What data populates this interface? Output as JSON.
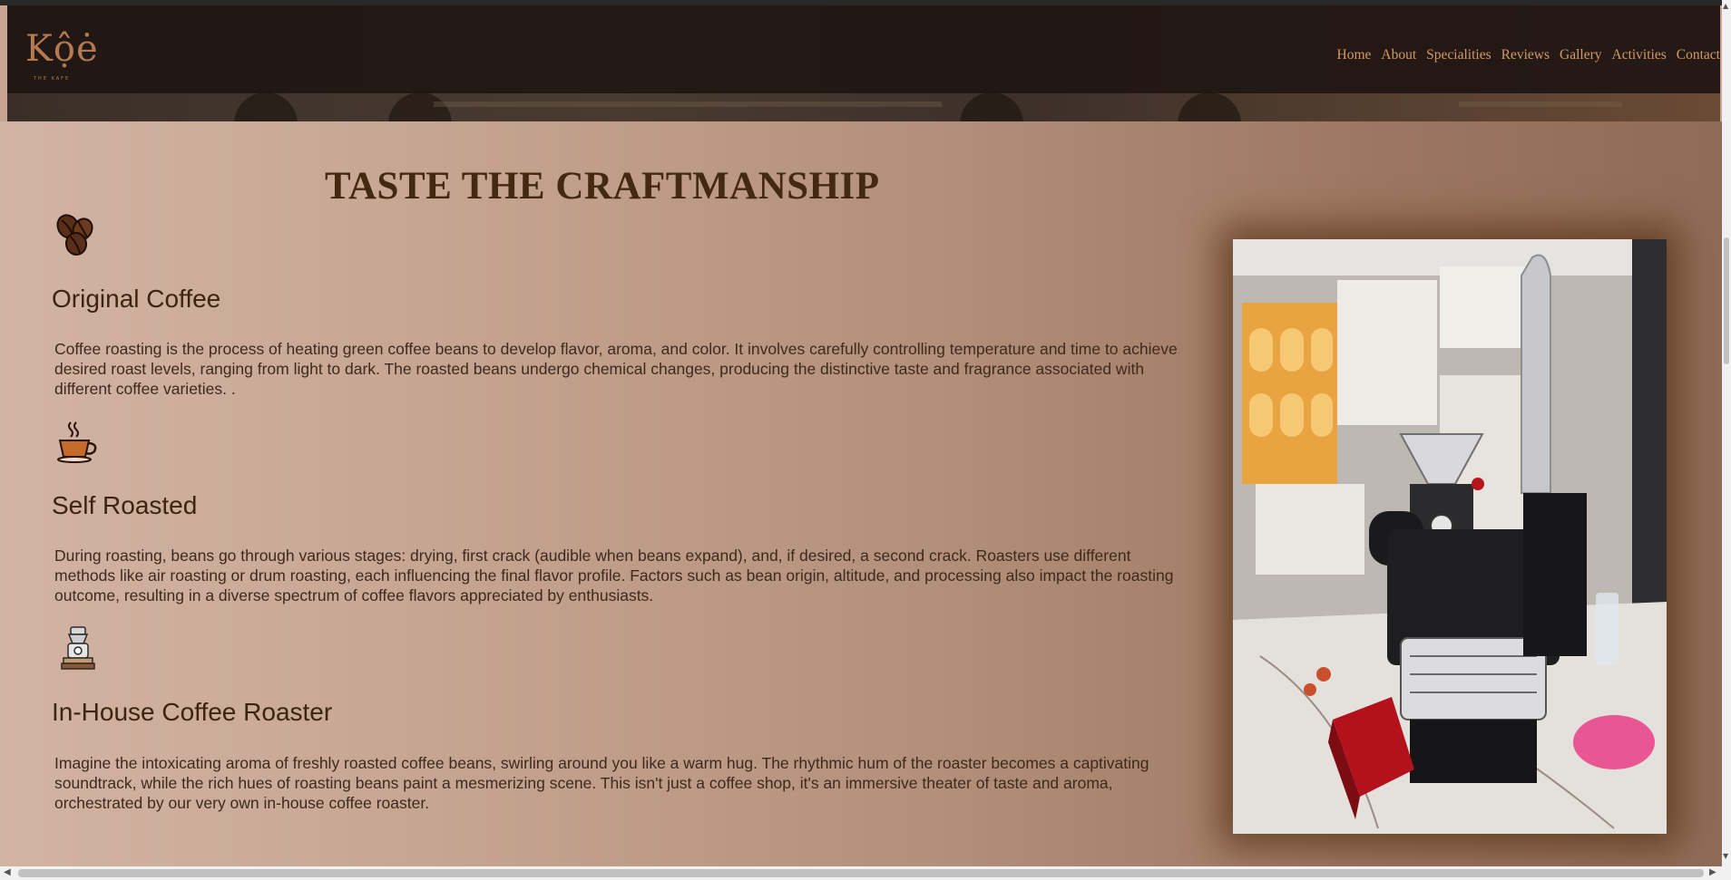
{
  "brand": {
    "logo_text": "Kộė",
    "logo_subtitle": "THE KAFE"
  },
  "nav": {
    "items": [
      "Home",
      "About",
      "Specialities",
      "Reviews",
      "Gallery",
      "Activities",
      "Contact"
    ]
  },
  "section": {
    "heading": "TASTE THE CRAFTMANSHIP",
    "features": [
      {
        "icon": "coffee-beans-icon",
        "title": "Original Coffee",
        "text": "Coffee roasting is the process of heating green coffee beans to develop flavor, aroma, and color. It involves carefully controlling temperature and time to achieve desired roast levels, ranging from light to dark. The roasted beans undergo chemical changes, producing the distinctive taste and fragrance associated with different coffee varieties. ."
      },
      {
        "icon": "coffee-cup-icon",
        "title": "Self Roasted",
        "text": "During roasting, beans go through various stages: drying, first crack (audible when beans expand), and, if desired, a second crack. Roasters use different methods like air roasting or drum roasting, each influencing the final flavor profile. Factors such as bean origin, altitude, and processing also impact the roasting outcome, resulting in a diverse spectrum of coffee flavors appreciated by enthusiasts."
      },
      {
        "icon": "coffee-roaster-icon",
        "title": "In-House Coffee Roaster",
        "text": "Imagine the intoxicating aroma of freshly roasted coffee beans, swirling around you like a warm hug. The rhythmic hum of the roaster becomes a captivating soundtrack, while the rich hues of roasting beans paint a mesmerizing scene. This isn't just a coffee shop, it's an immersive theater of taste and aroma, orchestrated by our very own in-house coffee roaster."
      }
    ],
    "photo": {
      "subject": "coffee roaster machine in cafe"
    }
  },
  "colors": {
    "heading": "#43290f",
    "nav_link": "#d19a66",
    "navbar_bg": "#1f1612",
    "logo": "#b57a4e"
  }
}
